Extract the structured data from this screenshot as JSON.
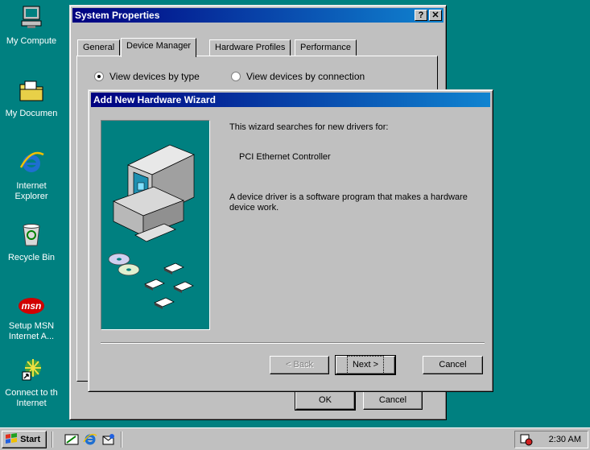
{
  "desktop": {
    "icons": [
      {
        "label": "My Compute",
        "icon": "my-computer-icon"
      },
      {
        "label": "My Documen",
        "icon": "my-documents-icon"
      },
      {
        "label": "Internet\nExplorer",
        "icon": "internet-explorer-icon"
      },
      {
        "label": "Recycle Bin",
        "icon": "recycle-bin-icon"
      },
      {
        "label": "Setup MSN\nInternet A...",
        "icon": "msn-icon"
      },
      {
        "label": "Connect to th\nInternet",
        "icon": "connect-internet-icon"
      }
    ],
    "msn_logo": "msn"
  },
  "system_properties": {
    "title": "System Properties",
    "help_button": "?",
    "close_button": "✕",
    "tabs": [
      {
        "label": "General"
      },
      {
        "label": "Device Manager",
        "active": true
      },
      {
        "label": "Hardware Profiles"
      },
      {
        "label": "Performance"
      }
    ],
    "radio_by_type": "View devices by type",
    "radio_by_connection": "View devices by connection",
    "ok_label": "OK",
    "cancel_label": "Cancel"
  },
  "wizard": {
    "title": "Add New Hardware Wizard",
    "line1": "This wizard searches for new drivers for:",
    "device": "PCI Ethernet Controller",
    "description": "A device driver is a software program that makes a hardware device work.",
    "back_label": "< Back",
    "next_label": "Next >",
    "cancel_label": "Cancel"
  },
  "taskbar": {
    "start_label": "Start",
    "clock": "2:30 AM",
    "quicklaunch": [
      "show-desktop-icon",
      "internet-explorer-icon",
      "outlook-express-icon"
    ]
  },
  "colors": {
    "desktop": "#008080",
    "titlebar": "#000080",
    "wizard_art_bg": "#008080"
  }
}
